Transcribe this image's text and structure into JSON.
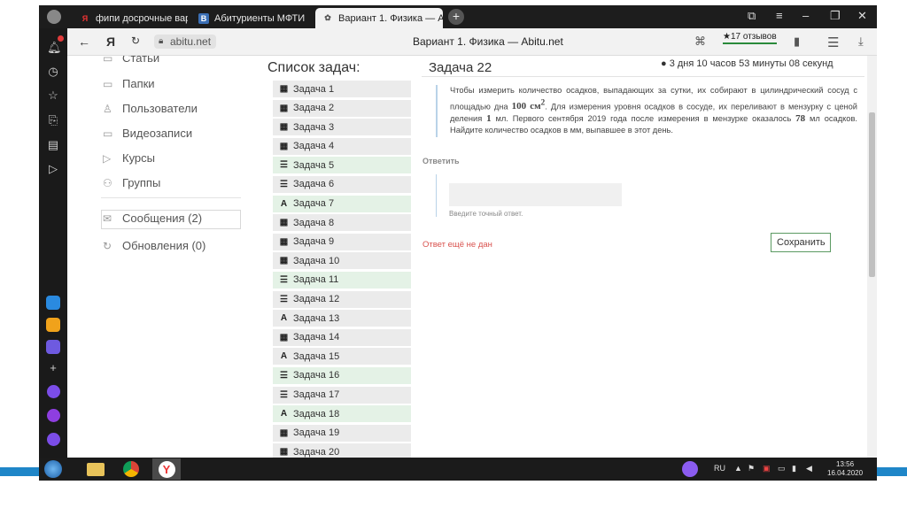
{
  "tabs": [
    {
      "label": "фипи досрочные вариант",
      "icon": "yandex-icon"
    },
    {
      "label": "Абитуриенты МФТИ",
      "icon": "vk-icon"
    },
    {
      "label": "Вариант 1. Физика — А",
      "icon": "abitu-icon"
    }
  ],
  "address": {
    "domain": "abitu.net",
    "page_title": "Вариант 1. Физика — Abitu.net",
    "reviews": "★17 отзывов"
  },
  "sidebar_menu": [
    {
      "label": "Статьи",
      "icon": "articles-icon"
    },
    {
      "label": "Папки",
      "icon": "folder-icon"
    },
    {
      "label": "Пользователи",
      "icon": "user-icon"
    },
    {
      "label": "Видеозаписи",
      "icon": "video-icon"
    },
    {
      "label": "Курсы",
      "icon": "courses-icon"
    },
    {
      "label": "Группы",
      "icon": "groups-icon"
    }
  ],
  "messages": "Сообщения (2)",
  "updates": "Обновления (0)",
  "tasks_title": "Список задач:",
  "tasks": [
    {
      "label": "Задача 1",
      "icon": "calculator-icon",
      "done": false
    },
    {
      "label": "Задача 2",
      "icon": "calculator-icon",
      "done": false
    },
    {
      "label": "Задача 3",
      "icon": "calculator-icon",
      "done": false
    },
    {
      "label": "Задача 4",
      "icon": "calculator-icon",
      "done": false
    },
    {
      "label": "Задача 5",
      "icon": "list-icon",
      "done": true
    },
    {
      "label": "Задача 6",
      "icon": "list-icon",
      "done": false
    },
    {
      "label": "Задача 7",
      "icon": "text-icon",
      "done": true
    },
    {
      "label": "Задача 8",
      "icon": "calculator-icon",
      "done": false
    },
    {
      "label": "Задача 9",
      "icon": "calculator-icon",
      "done": false
    },
    {
      "label": "Задача 10",
      "icon": "calculator-icon",
      "done": false
    },
    {
      "label": "Задача 11",
      "icon": "list-icon",
      "done": true
    },
    {
      "label": "Задача 12",
      "icon": "list-icon",
      "done": false
    },
    {
      "label": "Задача 13",
      "icon": "text-icon",
      "done": false
    },
    {
      "label": "Задача 14",
      "icon": "calculator-icon",
      "done": false
    },
    {
      "label": "Задача 15",
      "icon": "text-icon",
      "done": false
    },
    {
      "label": "Задача 16",
      "icon": "list-icon",
      "done": true
    },
    {
      "label": "Задача 17",
      "icon": "list-icon",
      "done": false
    },
    {
      "label": "Задача 18",
      "icon": "text-icon",
      "done": true
    },
    {
      "label": "Задача 19",
      "icon": "calculator-icon",
      "done": false
    },
    {
      "label": "Задача 20",
      "icon": "calculator-icon",
      "done": false
    }
  ],
  "problem": {
    "title": "Задача 22",
    "timer": "3 дня 10 часов 53 минуты 08 секунд",
    "text_1": "Чтобы измерить количество осадков, выпадающих за сутки, их собирают в цилиндрический сосуд с площадью дна ",
    "area": "100 см",
    "area_exp": "2",
    "text_2": ". Для измерения уровня осадков в сосуде, их переливают в мензурку с ценой деления ",
    "division": "1",
    "text_3": " мл. Первого сентября 2019 года после измерения в мензурке оказалось ",
    "volume": "78",
    "text_4": " мл осадков. Найдите количество осадков в мм, выпавшее в этот день.",
    "answer_label": "Ответить",
    "answer_value": "",
    "hint": "Введите точный ответ.",
    "status": "Ответ ещё не дан",
    "save": "Сохранить"
  },
  "taskbar": {
    "lang": "RU",
    "time": "13:56",
    "date": "16.04.2020"
  }
}
